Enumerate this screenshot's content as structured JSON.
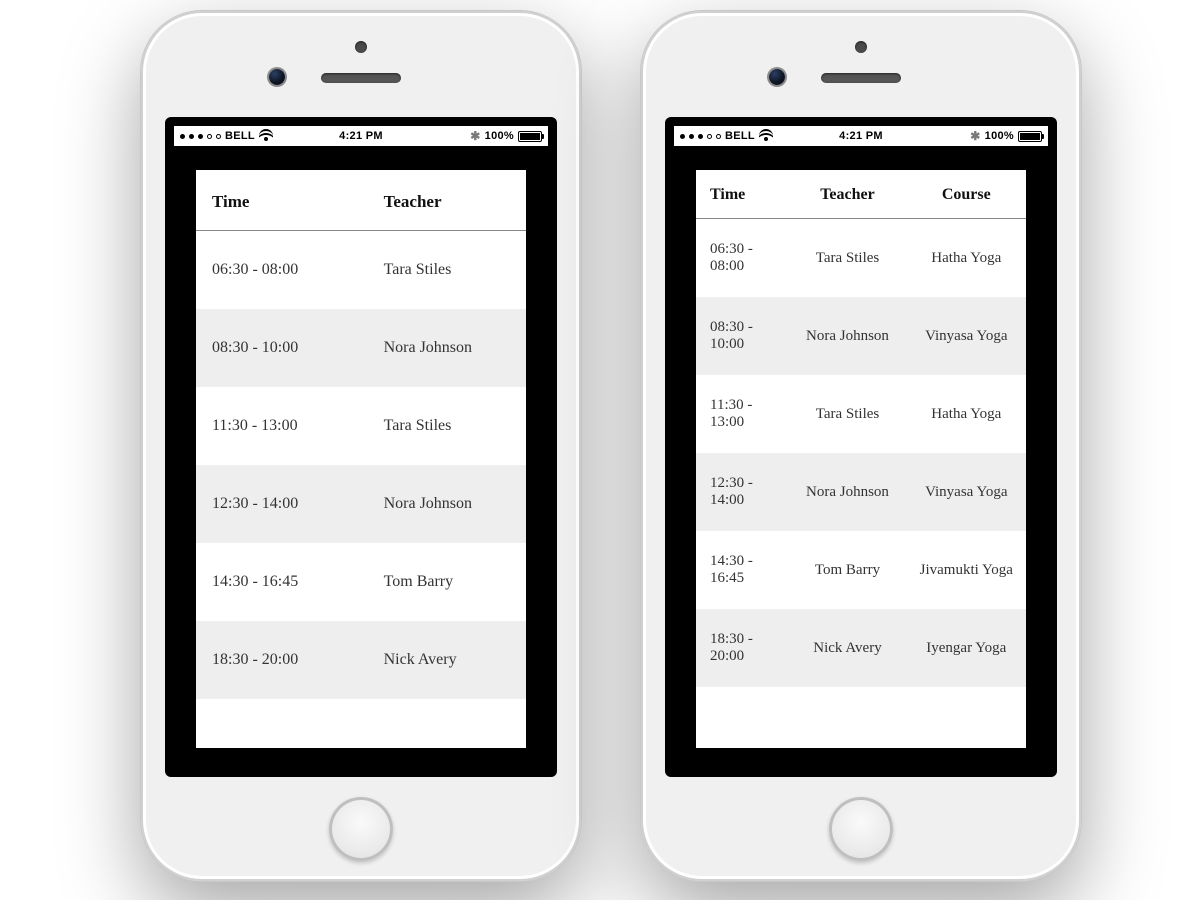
{
  "statusbar": {
    "carrier": "BELL",
    "time": "4:21 PM",
    "battery_pct": "100%"
  },
  "left": {
    "headers": {
      "time": "Time",
      "teacher": "Teacher"
    },
    "rows": [
      {
        "time": "06:30 - 08:00",
        "teacher": "Tara Stiles"
      },
      {
        "time": "08:30 - 10:00",
        "teacher": "Nora Johnson"
      },
      {
        "time": "11:30 - 13:00",
        "teacher": "Tara Stiles"
      },
      {
        "time": "12:30 - 14:00",
        "teacher": "Nora Johnson"
      },
      {
        "time": "14:30 - 16:45",
        "teacher": "Tom Barry"
      },
      {
        "time": "18:30 - 20:00",
        "teacher": "Nick Avery"
      }
    ]
  },
  "right": {
    "headers": {
      "time": "Time",
      "teacher": "Teacher",
      "course": "Course"
    },
    "rows": [
      {
        "time": "06:30 - 08:00",
        "teacher": "Tara Stiles",
        "course": "Hatha Yoga"
      },
      {
        "time": "08:30 - 10:00",
        "teacher": "Nora Johnson",
        "course": "Vinyasa Yoga"
      },
      {
        "time": "11:30 - 13:00",
        "teacher": "Tara Stiles",
        "course": "Hatha Yoga"
      },
      {
        "time": "12:30 - 14:00",
        "teacher": "Nora Johnson",
        "course": "Vinyasa Yoga"
      },
      {
        "time": "14:30 - 16:45",
        "teacher": "Tom Barry",
        "course": "Jivamukti Yoga"
      },
      {
        "time": "18:30 - 20:00",
        "teacher": "Nick Avery",
        "course": "Iyengar Yoga"
      }
    ]
  }
}
